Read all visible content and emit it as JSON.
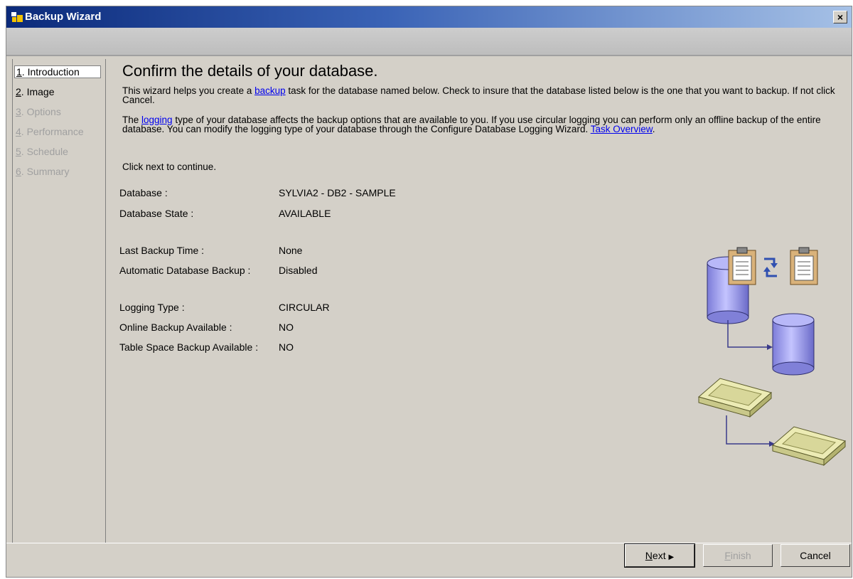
{
  "window": {
    "title": "Backup Wizard",
    "close_glyph": "×"
  },
  "nav": [
    {
      "num": "1",
      "label": ". Introduction",
      "state": "selected"
    },
    {
      "num": "2",
      "label": ". Image",
      "state": "enabled"
    },
    {
      "num": "3",
      "label": ". Options",
      "state": "disabled"
    },
    {
      "num": "4",
      "label": ". Performance",
      "state": "disabled"
    },
    {
      "num": "5",
      "label": ". Schedule",
      "state": "disabled"
    },
    {
      "num": "6",
      "label": ". Summary",
      "state": "disabled"
    }
  ],
  "content": {
    "heading": "Confirm the details of your database.",
    "para1": {
      "before": "This wizard helps you create a ",
      "link": "backup",
      "after": " task for the database named below. Check to insure that the database listed below is the one that you want to backup. If not click Cancel."
    },
    "para2": {
      "before": "The ",
      "link": "logging",
      "after": " type of your database affects the backup options that are available to you. If you use circular logging you can perform only an offline backup of the entire database. You can modify the logging type of your database through the Configure Database Logging Wizard. ",
      "link2": "Task Overview",
      "tail": "."
    },
    "para3": "Click next to continue.",
    "details": [
      {
        "label": "Database :",
        "value": "SYLVIA2 - DB2 - SAMPLE"
      },
      {
        "label": "Database State :",
        "value": "AVAILABLE"
      },
      {
        "label": "Last Backup Time :",
        "value": "None"
      },
      {
        "label": "Automatic Database Backup :",
        "value": "Disabled"
      },
      {
        "label": "Logging Type :",
        "value": "CIRCULAR"
      },
      {
        "label": "Online Backup Available :",
        "value": "NO"
      },
      {
        "label": "Table Space Backup Available :",
        "value": "NO"
      }
    ]
  },
  "buttons": {
    "next": {
      "label_u": "N",
      "label_rest": "ext",
      "arrow": "▶"
    },
    "finish": {
      "label_u": "F",
      "label_rest": "inish"
    },
    "cancel": {
      "label": "Cancel"
    }
  },
  "colors": {
    "titlebar_start": "#0b2a7a",
    "cylinder": "#a8a8f0",
    "tray": "#e6e6a8",
    "link": "#0000ee"
  },
  "icons": [
    "wizard-app-icon",
    "close-icon",
    "clipboard-icon",
    "sync-arrows-icon",
    "database-cylinder-icon",
    "tape-tray-icon",
    "next-arrow-icon"
  ]
}
